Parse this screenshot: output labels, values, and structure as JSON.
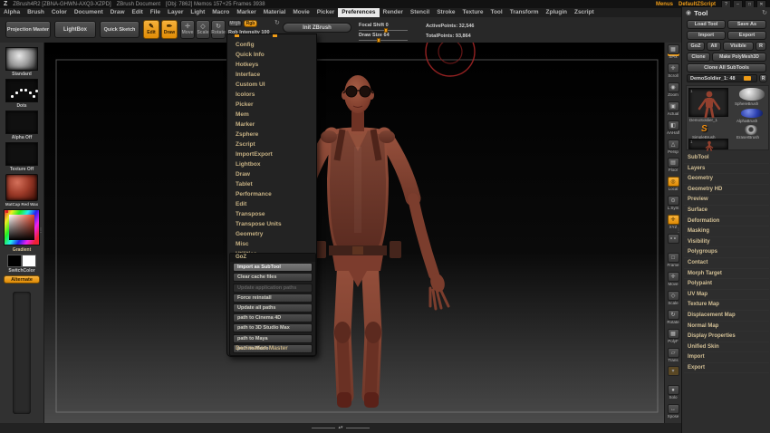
{
  "title_bar": {
    "logo": "Z",
    "app_title": "ZBrush4R2  [ZBNA-GHWN-AXQ3-XZPD]",
    "doc_title": "ZBrush Document",
    "doc_stats": "[Obj: 7862]  Memos 157+25  Frames 3938",
    "menus_label": "Menus",
    "zscript_label": "DefaultZScript",
    "window_buttons": [
      {
        "glyph": "?"
      },
      {
        "glyph": "–"
      },
      {
        "glyph": "□"
      },
      {
        "glyph": "✕"
      }
    ]
  },
  "menu_bar": {
    "items": [
      {
        "label": "Alpha"
      },
      {
        "label": "Brush"
      },
      {
        "label": "Color"
      },
      {
        "label": "Document"
      },
      {
        "label": "Draw"
      },
      {
        "label": "Edit"
      },
      {
        "label": "File"
      },
      {
        "label": "Layer"
      },
      {
        "label": "Light"
      },
      {
        "label": "Macro"
      },
      {
        "label": "Marker"
      },
      {
        "label": "Material"
      },
      {
        "label": "Movie"
      },
      {
        "label": "Picker"
      },
      {
        "label": "Preferences",
        "state": "active"
      },
      {
        "label": "Render"
      },
      {
        "label": "Stencil"
      },
      {
        "label": "Stroke"
      },
      {
        "label": "Texture"
      },
      {
        "label": "Tool"
      },
      {
        "label": "Transform"
      },
      {
        "label": "Zplugin"
      },
      {
        "label": "Zscript"
      }
    ]
  },
  "shelf": {
    "projection_master": "Projection Master",
    "lightbox": "LightBox",
    "quick_sketch": "Quick Sketch",
    "edit": "Edit",
    "draw": "Draw",
    "move": "Move",
    "scale": "Scale",
    "rotate": "Rotate",
    "mrgb": "Mrgb",
    "rgb": "Rgb",
    "rgb_intensity": "Rgb Intensity 100",
    "init_zbrush": "Init ZBrush",
    "focal_shift": "Focal Shift 0",
    "draw_size": "Draw Size 64",
    "active_points": "ActivePoints: 32,546",
    "total_points": "TotalPoints: 93,864"
  },
  "prefs_menu": {
    "items": [
      "Config",
      "Quick Info",
      "Hotkeys",
      "Interface",
      "Custom UI",
      "Icolors",
      "Picker",
      "Mem",
      "Marker",
      "Zsphere",
      "Zscript",
      "ImportExport",
      "Lightbox",
      "Draw",
      "Tablet",
      "Performance",
      "Edit",
      "Transpose",
      "Transpose Units",
      "Geometry",
      "Misc",
      "Utilities"
    ],
    "goz_header": "GoZ",
    "goz_items": [
      {
        "label": "Import as SubTool",
        "state": "hl"
      },
      {
        "label": "Clear cache files"
      },
      {
        "label": "Update application paths",
        "state": "disabled"
      },
      {
        "label": "Force reinstall"
      },
      {
        "label": "Update all paths"
      },
      {
        "label": "path to Cinema 4D"
      },
      {
        "label": "path to 3D Studio Max"
      },
      {
        "label": "path to Maya"
      },
      {
        "label": "path to Modo"
      }
    ],
    "decimation_master": "Decimation Master"
  },
  "left_tray": {
    "brush_label": "Standard",
    "stroke_label": "Dots",
    "alpha_label": "Alpha Off",
    "texture_label": "Texture Off",
    "material_label": "MatCap Red Wax",
    "gradient_label": "Gradient",
    "switch_label": "SwitchColor",
    "alternate_label": "Alternate"
  },
  "right_shelf": {
    "items": [
      {
        "label": "SPix",
        "glyph": "▦",
        "state": "mark"
      },
      {
        "label": "Scroll",
        "glyph": "✛"
      },
      {
        "label": "Zoom",
        "glyph": "◉"
      },
      {
        "label": "Actual",
        "glyph": "▣"
      },
      {
        "label": "AAHalf",
        "glyph": "◧"
      },
      {
        "label": "Persp",
        "glyph": "△"
      },
      {
        "label": "Floor",
        "glyph": "▤"
      },
      {
        "label": "Local",
        "glyph": "◎",
        "state": "on"
      },
      {
        "label": "L.Sym",
        "glyph": "⊙"
      },
      {
        "label": "XYZ",
        "glyph": "✛",
        "state": "on"
      },
      {
        "label": "",
        "glyph": "∘∘"
      },
      {
        "label": "Frame",
        "glyph": "□"
      },
      {
        "label": "Move",
        "glyph": "✛"
      },
      {
        "label": "Scale",
        "glyph": "◇"
      },
      {
        "label": "Rotate",
        "glyph": "↻"
      },
      {
        "label": "PolyF",
        "glyph": "▦"
      },
      {
        "label": "Trans",
        "glyph": "▱"
      },
      {
        "label": "",
        "glyph": "▾",
        "state": "dim"
      },
      {
        "label": "Solo",
        "glyph": "●"
      },
      {
        "label": "Xpose",
        "glyph": "↔"
      }
    ]
  },
  "tool_palette": {
    "title": "Tool",
    "load_tool": "Load Tool",
    "save_as": "Save As",
    "import": "Import",
    "export": "Export",
    "goz": "GoZ",
    "all": "All",
    "visible": "Visible",
    "r": "R",
    "clone": "Clone",
    "make_polymesh": "Make PolyMesh3D",
    "clone_all": "Clone All SubTools",
    "slider_label": "DemoSoldier_1: 48",
    "slider_r": "R",
    "thumb_current": "DemoSoldier_1",
    "thumb_sphere": "SphereBrush",
    "thumb_alpha": "AlphaBrush",
    "thumb_simple": "SimpleBrush",
    "thumb_eraser": "EraserBrush",
    "thumb_badge": "1",
    "sections": [
      "SubTool",
      "Layers",
      "Geometry",
      "Geometry HD",
      "Preview",
      "Surface",
      "Deformation",
      "Masking",
      "Visibility",
      "Polygroups",
      "Contact",
      "Morph Target",
      "Polypaint",
      "UV Map",
      "Texture Map",
      "Displacement Map",
      "Normal Map",
      "Display Properties",
      "Unified Skin",
      "Import",
      "Export"
    ]
  },
  "colors": {
    "accent": "#ee9c17",
    "model_skin": "#8a4533",
    "cursor_ring": "#a32525"
  }
}
